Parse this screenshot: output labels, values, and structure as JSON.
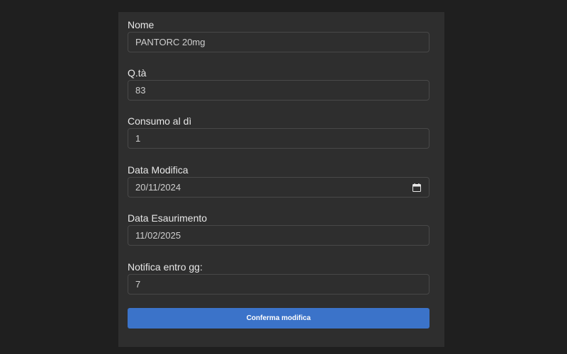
{
  "form": {
    "nome": {
      "label": "Nome",
      "value": "PANTORC 20mg"
    },
    "quantita": {
      "label": "Q.tà",
      "value": "83"
    },
    "consumo": {
      "label": "Consumo al dì",
      "value": "1"
    },
    "data_modifica": {
      "label": "Data Modifica",
      "value": "20/11/2024"
    },
    "data_esaurimento": {
      "label": "Data Esaurimento",
      "value": "11/02/2025"
    },
    "notifica": {
      "label": "Notifica entro gg:",
      "value": "7"
    },
    "submit_label": "Conferma modifica"
  },
  "icons": {
    "date_picker": "calendar-icon"
  },
  "colors": {
    "page_background": "#1f1f1f",
    "panel_background": "#2e2e2e",
    "primary_button": "#3b73c9"
  }
}
